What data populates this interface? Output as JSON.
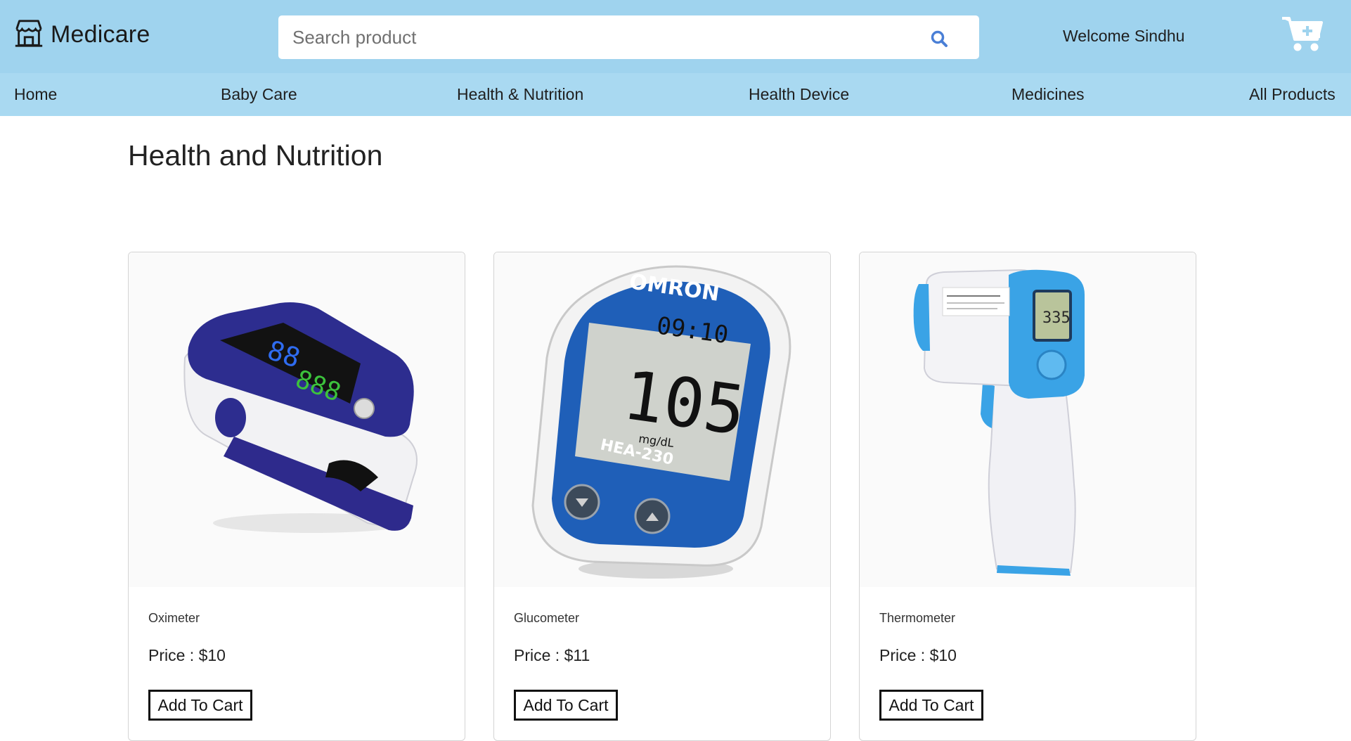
{
  "header": {
    "brand": "Medicare",
    "brand_icon": "store-icon",
    "search_placeholder": "Search product",
    "search_icon": "search-icon",
    "welcome": "Welcome Sindhu",
    "cart_icon": "cart-plus-icon"
  },
  "nav": {
    "items": [
      {
        "label": "Home"
      },
      {
        "label": "Baby Care"
      },
      {
        "label": "Health & Nutrition"
      },
      {
        "label": "Health Device"
      },
      {
        "label": "Medicines"
      },
      {
        "label": "All Products"
      }
    ]
  },
  "main": {
    "title": "Health and Nutrition",
    "products": [
      {
        "name": "Oximeter",
        "price": "Price : $10",
        "button": "Add To Cart",
        "image": "oximeter-image"
      },
      {
        "name": "Glucometer",
        "price": "Price : $11",
        "button": "Add To Cart",
        "image": "glucometer-image"
      },
      {
        "name": "Thermometer",
        "price": "Price : $10",
        "button": "Add To Cart",
        "image": "thermometer-image"
      }
    ]
  },
  "colors": {
    "header_bg": "#9fd3ee",
    "nav_bg": "#a9d9f1",
    "search_icon": "#4a7fd6",
    "cart_icon": "#ffffff"
  }
}
